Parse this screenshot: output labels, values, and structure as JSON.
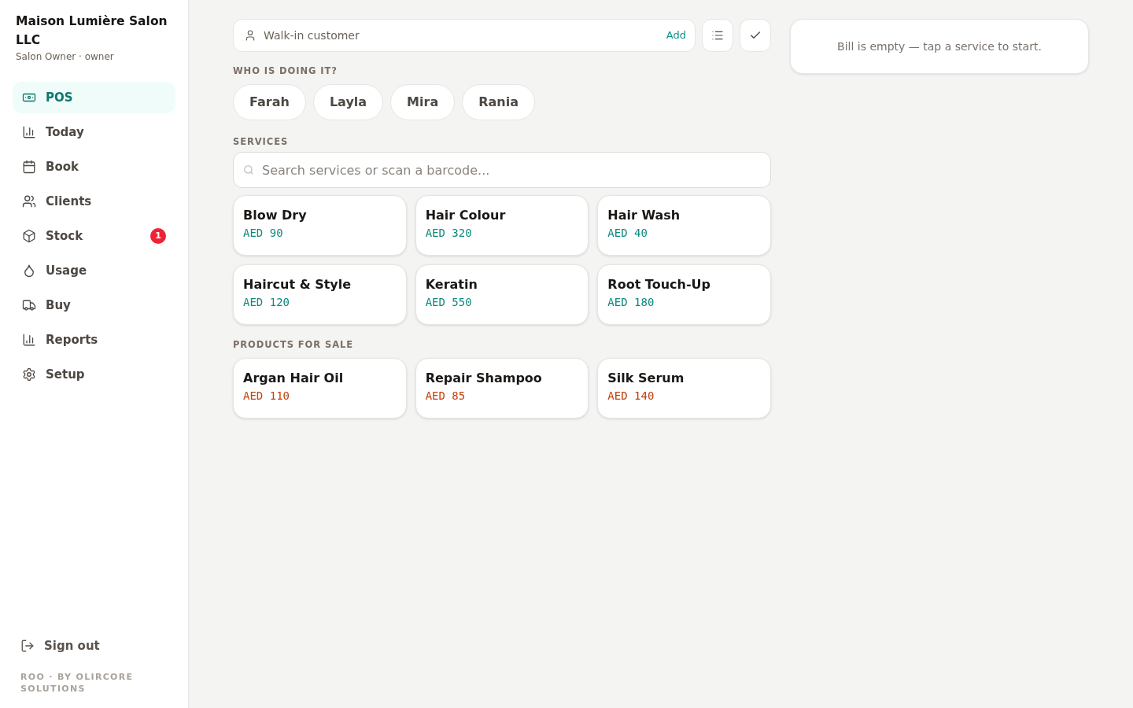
{
  "sidebar": {
    "business_name": "Maison Lumière Salon LLC",
    "user_role": "Salon Owner · owner",
    "nav_items": [
      {
        "label": "POS",
        "selected": true
      },
      {
        "label": "Today",
        "selected": false
      },
      {
        "label": "Book",
        "selected": false
      },
      {
        "label": "Clients",
        "selected": false
      },
      {
        "label": "Stock",
        "selected": false,
        "badge": "1"
      },
      {
        "label": "Usage",
        "selected": false
      },
      {
        "label": "Buy",
        "selected": false
      },
      {
        "label": "Reports",
        "selected": false
      },
      {
        "label": "Setup",
        "selected": false
      }
    ],
    "sign_out": "Sign out",
    "footer": "ROO · BY OLIRCORE SOLUTIONS"
  },
  "customer": {
    "placeholder": "Walk-in customer",
    "add_label": "Add"
  },
  "staff_section": {
    "title": "WHO IS DOING IT?",
    "staff": [
      {
        "name": "Farah",
        "selected": false
      },
      {
        "name": "Layla",
        "selected": false
      },
      {
        "name": "Mira",
        "selected": false
      },
      {
        "name": "Rania",
        "selected": false
      }
    ]
  },
  "services_section": {
    "title": "SERVICES",
    "search": {
      "placeholder": "Search services or scan a barcode..."
    },
    "items": [
      {
        "name": "Blow Dry",
        "price": "AED 90"
      },
      {
        "name": "Hair Colour",
        "price": "AED 320"
      },
      {
        "name": "Hair Wash",
        "price": "AED 40"
      },
      {
        "name": "Haircut & Style",
        "price": "AED 120"
      },
      {
        "name": "Keratin",
        "price": "AED 550"
      },
      {
        "name": "Root Touch-Up",
        "price": "AED 180"
      }
    ]
  },
  "products_section": {
    "title": "PRODUCTS FOR SALE",
    "items": [
      {
        "name": "Argan Hair Oil",
        "price": "AED 110"
      },
      {
        "name": "Repair Shampoo",
        "price": "AED 85"
      },
      {
        "name": "Silk Serum",
        "price": "AED 140"
      }
    ]
  },
  "bill": {
    "empty_message": "Bill is empty — tap a service to start."
  }
}
